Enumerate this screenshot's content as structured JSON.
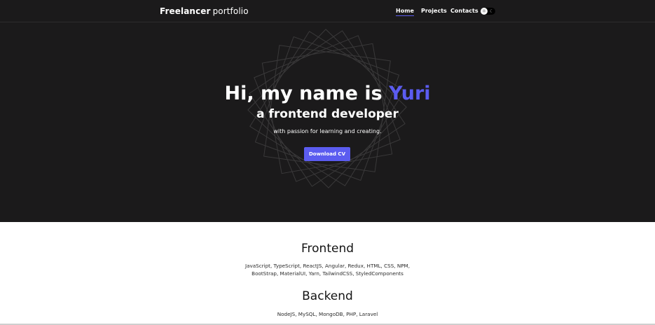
{
  "header": {
    "brand_strong": "Freelancer",
    "brand_light": "portfolio",
    "nav": {
      "home": "Home",
      "projects": "Projects",
      "contacts": "Contacts"
    },
    "theme_toggle": {
      "light_icon": "sun-icon",
      "dark_icon": "moon-icon"
    }
  },
  "hero": {
    "title_prefix": "Hi, my name is",
    "title_name": "Yuri",
    "subtitle": "a frontend developer",
    "description": "with passion for learning and creating.",
    "cta_label": "Download CV"
  },
  "skills": {
    "frontend": {
      "heading": "Frontend",
      "list": "JavaScript, TypeScript, ReactJS, Angular, Redux, HTML, CSS, NPM, BootStrap, MaterialUI, Yarn, TailwindCSS, StyledComponents"
    },
    "backend": {
      "heading": "Backend",
      "list": "NodeJS, MySQL, MongoDB, PHP, Laravel"
    }
  },
  "colors": {
    "hero_bg": "#1b1a1b",
    "accent": "#5b5cf0",
    "text_light": "#ffffff",
    "text_dark": "#141414"
  }
}
